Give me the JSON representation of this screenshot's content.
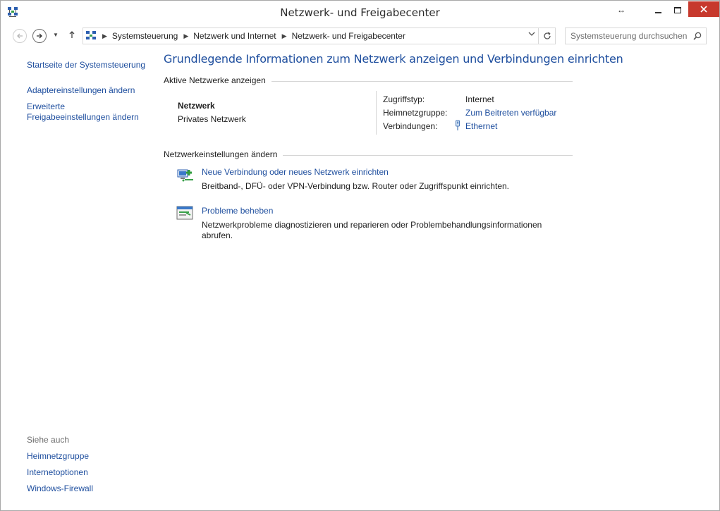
{
  "window": {
    "title": "Netzwerk- und Freigabecenter"
  },
  "nav": {
    "breadcrumbs": [
      "Systemsteuerung",
      "Netzwerk und Internet",
      "Netzwerk- und Freigabecenter"
    ],
    "search_placeholder": "Systemsteuerung durchsuchen"
  },
  "sidebar": {
    "links": [
      "Startseite der Systemsteuerung",
      "Adaptereinstellungen ändern",
      "Erweiterte Freigabeeinstellungen ändern"
    ],
    "see_also_label": "Siehe auch",
    "see_also": [
      "Heimnetzgruppe",
      "Internetoptionen",
      "Windows-Firewall"
    ]
  },
  "main": {
    "title": "Grundlegende Informationen zum Netzwerk anzeigen und Verbindungen einrichten",
    "active_networks_heading": "Aktive Netzwerke anzeigen",
    "network": {
      "name": "Netzwerk",
      "type": "Privates Netzwerk",
      "access_type_label": "Zugriffstyp:",
      "access_type_value": "Internet",
      "homegroup_label": "Heimnetzgruppe:",
      "homegroup_value": "Zum Beitreten verfügbar",
      "connections_label": "Verbindungen:",
      "connections_value": "Ethernet"
    },
    "settings_heading": "Netzwerkeinstellungen ändern",
    "tasks": [
      {
        "link": "Neue Verbindung oder neues Netzwerk einrichten",
        "description": "Breitband-, DFÜ- oder VPN-Verbindung bzw. Router oder Zugriffspunkt einrichten."
      },
      {
        "link": "Probleme beheben",
        "description": "Netzwerkprobleme diagnostizieren und reparieren oder Problembehandlungsinformationen abrufen."
      }
    ]
  },
  "colors": {
    "link": "#1e4e9e",
    "close_button": "#c7392d"
  },
  "icons": [
    "network-center-icon",
    "ethernet-icon",
    "new-connection-icon",
    "troubleshoot-icon",
    "search-icon",
    "refresh-icon"
  ]
}
